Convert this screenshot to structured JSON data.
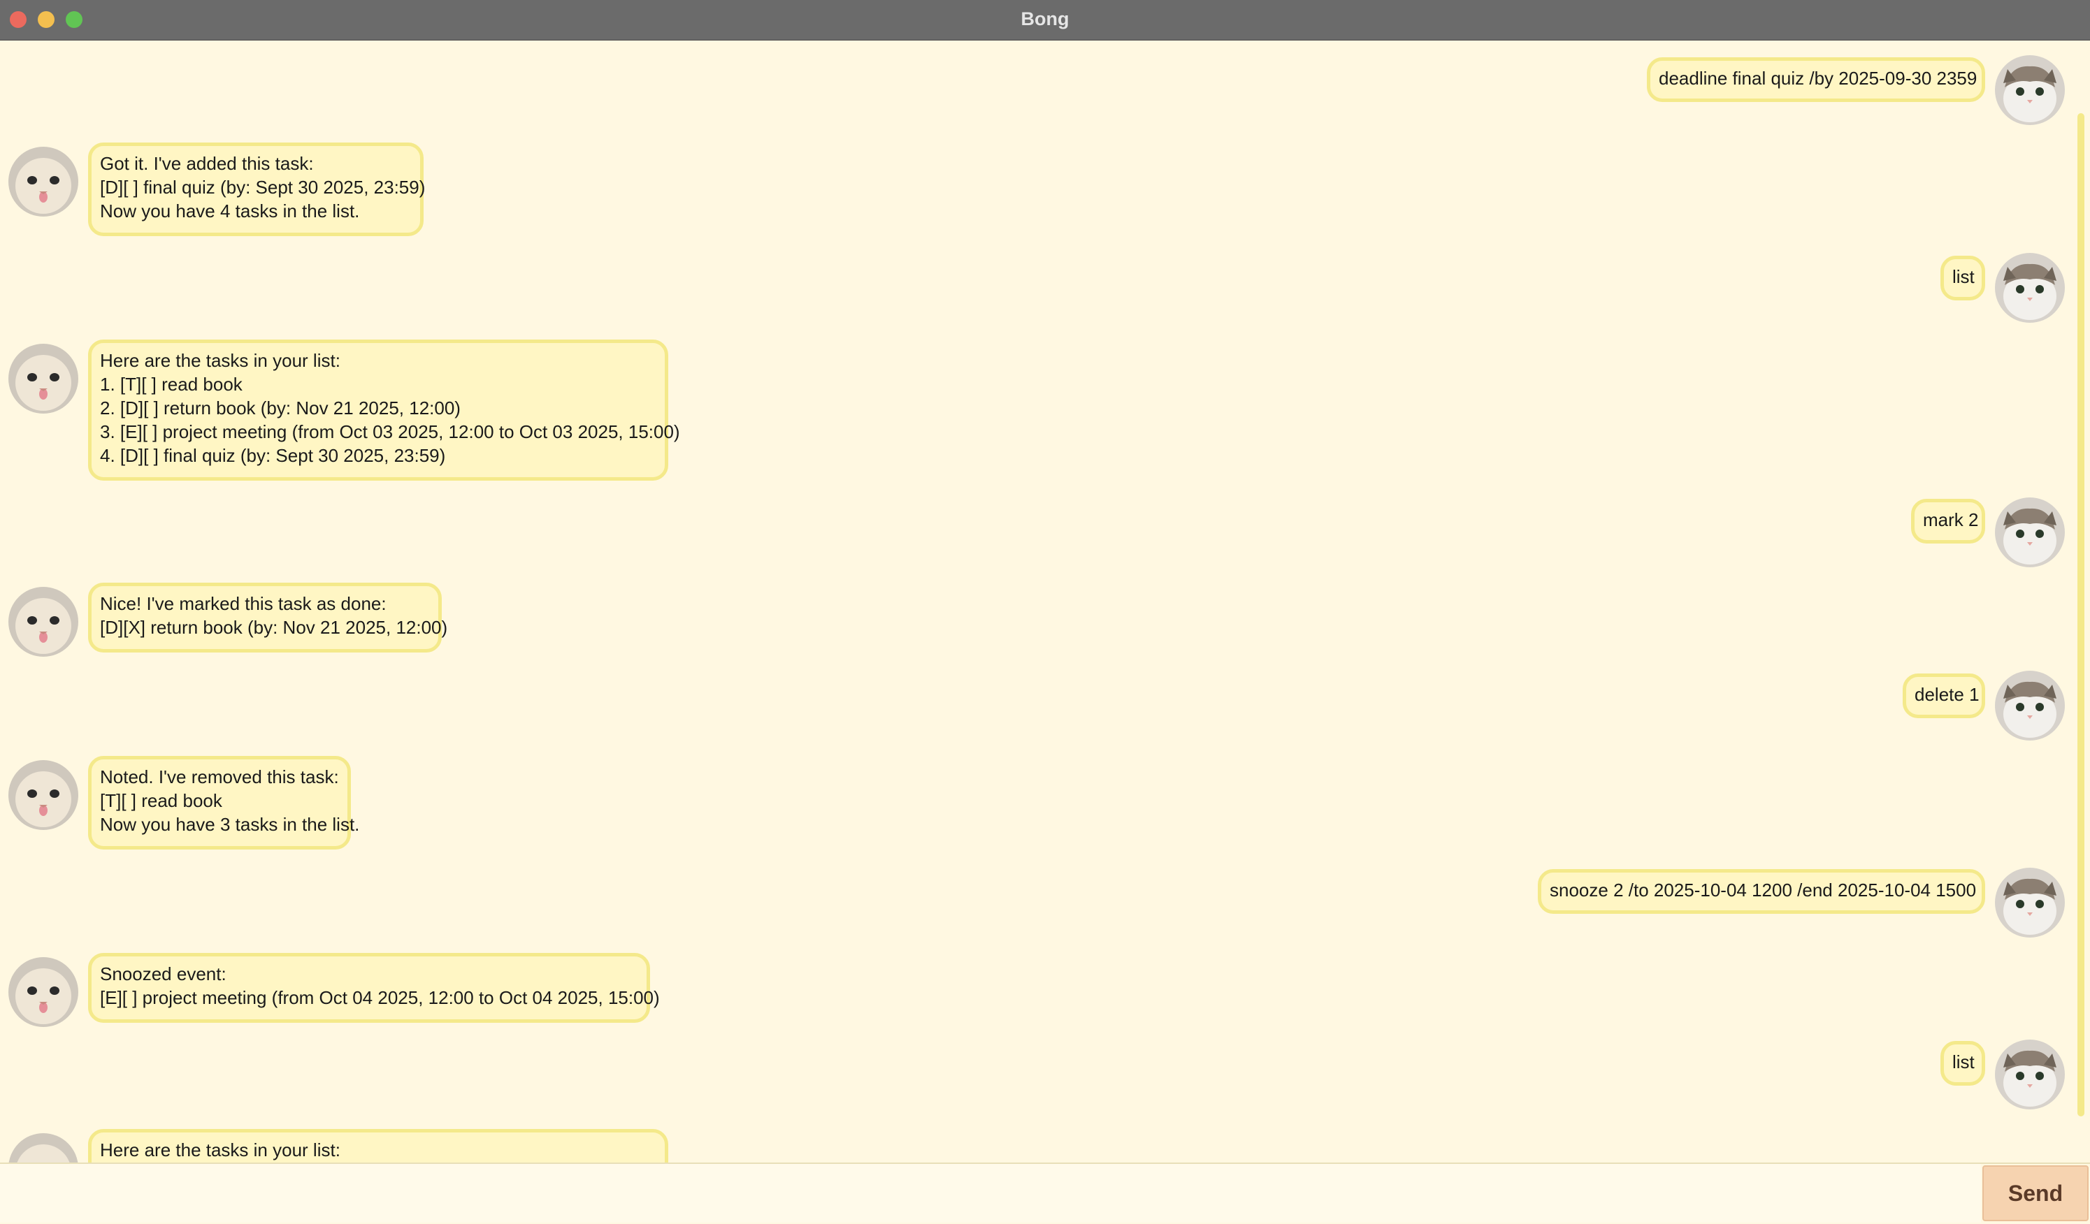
{
  "window": {
    "title": "Bong"
  },
  "messages": [
    {
      "from": "user",
      "text": "deadline final quiz /by 2025-09-30 2359"
    },
    {
      "from": "bot",
      "text": "Got it. I've added this task:\n[D][ ] final quiz (by: Sept 30 2025, 23:59)\nNow you have 4 tasks in the list."
    },
    {
      "from": "user",
      "text": "list"
    },
    {
      "from": "bot",
      "text": "Here are the tasks in your list:\n1. [T][ ] read book\n2. [D][ ] return book (by: Nov 21 2025, 12:00)\n3. [E][ ] project meeting (from Oct 03 2025, 12:00 to Oct 03 2025, 15:00)\n4. [D][ ] final quiz (by: Sept 30 2025, 23:59)"
    },
    {
      "from": "user",
      "text": "mark 2"
    },
    {
      "from": "bot",
      "text": "Nice! I've marked this task as done:\n[D][X] return book (by: Nov 21 2025, 12:00)"
    },
    {
      "from": "user",
      "text": "delete 1"
    },
    {
      "from": "bot",
      "text": "Noted. I've removed this task:\n[T][ ] read book\nNow you have 3 tasks in the list."
    },
    {
      "from": "user",
      "text": "snooze 2 /to 2025-10-04 1200 /end 2025-10-04 1500"
    },
    {
      "from": "bot",
      "text": "Snoozed event:\n[E][ ] project meeting (from Oct 04 2025, 12:00 to Oct 04 2025, 15:00)"
    },
    {
      "from": "user",
      "text": "list"
    },
    {
      "from": "bot",
      "text": "Here are the tasks in your list:"
    }
  ],
  "input": {
    "value": "",
    "placeholder": ""
  },
  "send_label": "Send",
  "colors": {
    "background": "#fff8e1",
    "bubble_fill": "#fff6c4",
    "bubble_border": "#f4e98a",
    "titlebar": "#6b6b6b",
    "send_button": "#f6d3b0"
  },
  "icons": {
    "user_avatar": "cat-avatar-icon",
    "bot_avatar": "cat-avatar-icon"
  }
}
